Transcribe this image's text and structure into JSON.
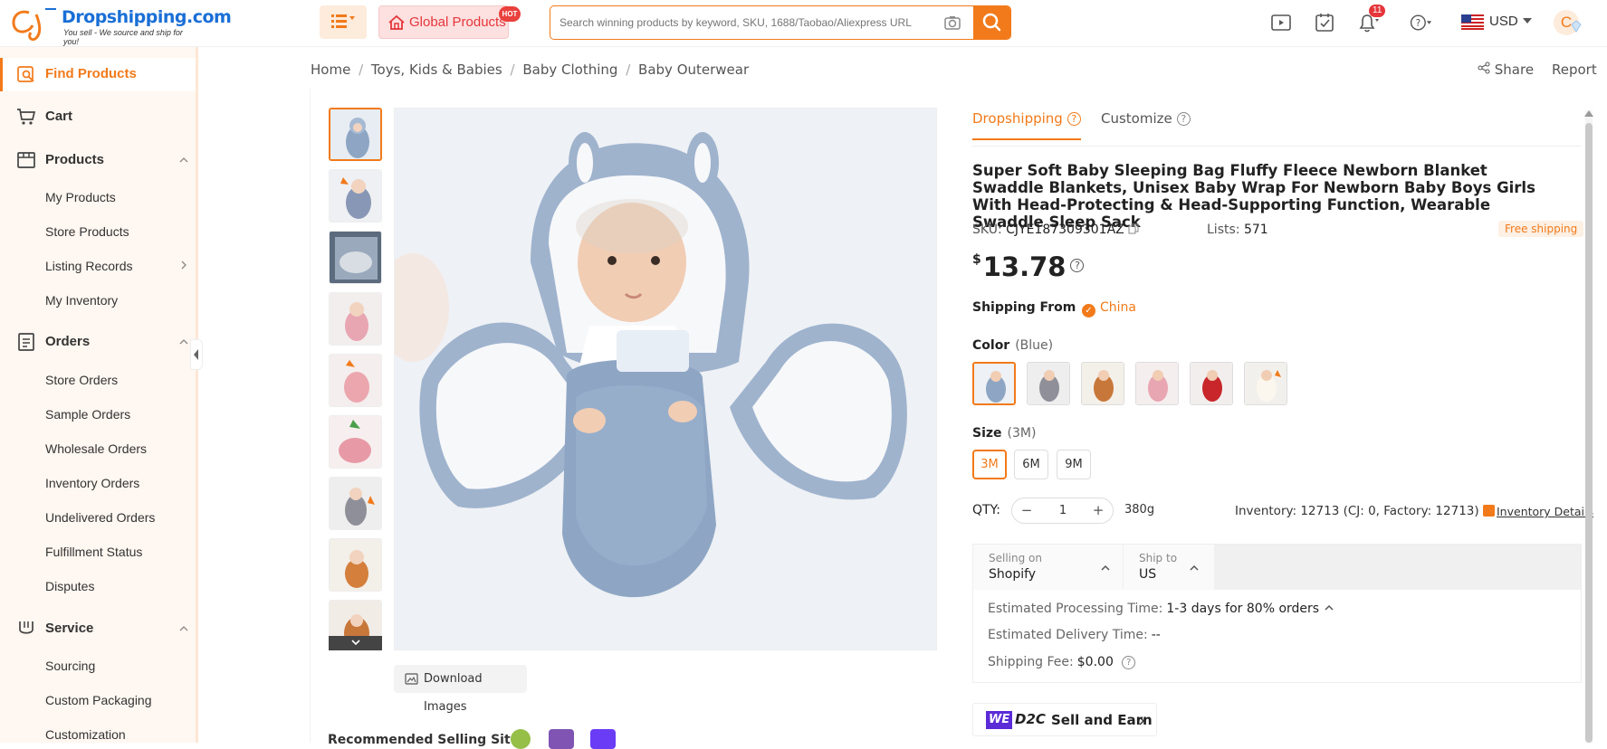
{
  "header": {
    "logo_brand": "Dropshipping.com",
    "logo_tagline": "You sell - We source and ship for you!",
    "global_products": "Global Products",
    "hot_badge": "HOT",
    "search_placeholder": "Search winning products by keyword, SKU, 1688/Taobao/Aliexpress URL",
    "notification_count": "11",
    "currency": "USD",
    "accent_color": "#f27a1a"
  },
  "sidebar": {
    "find_products": "Find Products",
    "cart": "Cart",
    "products": {
      "label": "Products",
      "items": [
        "My Products",
        "Store Products",
        "Listing Records",
        "My Inventory"
      ]
    },
    "orders": {
      "label": "Orders",
      "items": [
        "Store Orders",
        "Sample Orders",
        "Wholesale Orders",
        "Inventory Orders",
        "Undelivered Orders",
        "Fulfillment Status",
        "Disputes"
      ]
    },
    "service": {
      "label": "Service",
      "items": [
        "Sourcing",
        "Custom Packaging",
        "Customization"
      ]
    }
  },
  "breadcrumb": [
    "Home",
    "/",
    "Toys, Kids & Babies",
    "/",
    "Baby Clothing",
    "/",
    "Baby Outerwear"
  ],
  "actions": {
    "share": "Share",
    "report": "Report"
  },
  "gallery": {
    "download_images": "Download Images",
    "recommended_label": "Recommended Selling Site"
  },
  "product": {
    "tabs": [
      "Dropshipping",
      "Customize"
    ],
    "title": "Super Soft Baby Sleeping Bag Fluffy Fleece Newborn Blanket Swaddle Blankets, Unisex Baby Wrap For Newborn Baby Boys Girls With Head-Protecting & Head-Supporting Function, Wearable Swaddle Sleep Sack",
    "sku_label": "SKU:",
    "sku": "CJYE187309301AZ",
    "lists_label": "Lists:",
    "lists": "571",
    "free_shipping": "Free shipping",
    "currency_symbol": "$",
    "price": "13.78",
    "shipping_from_label": "Shipping From",
    "shipping_from": "China",
    "color_label": "Color",
    "color_value": "(Blue)",
    "size_label": "Size",
    "size_value": "(3M)",
    "sizes": [
      "3M",
      "6M",
      "9M"
    ],
    "qty_label": "QTY:",
    "qty": "1",
    "weight": "380g",
    "inventory": "Inventory: 12713  (CJ: 0, Factory: 12713)",
    "inventory_details": "Inventory Details"
  },
  "shipping": {
    "selling_on_label": "Selling on",
    "selling_on": "Shopify",
    "ship_to_label": "Ship to",
    "ship_to": "US",
    "processing_label": "Estimated Processing Time:",
    "processing_value": "1-3 days for 80% orders",
    "delivery_label": "Estimated Delivery Time:",
    "delivery_value": "--",
    "fee_label": "Shipping Fee:",
    "fee_value": "$0.00"
  },
  "d2c": {
    "we": "WE",
    "d2c": "D2C",
    "label": "Sell and Earn"
  }
}
